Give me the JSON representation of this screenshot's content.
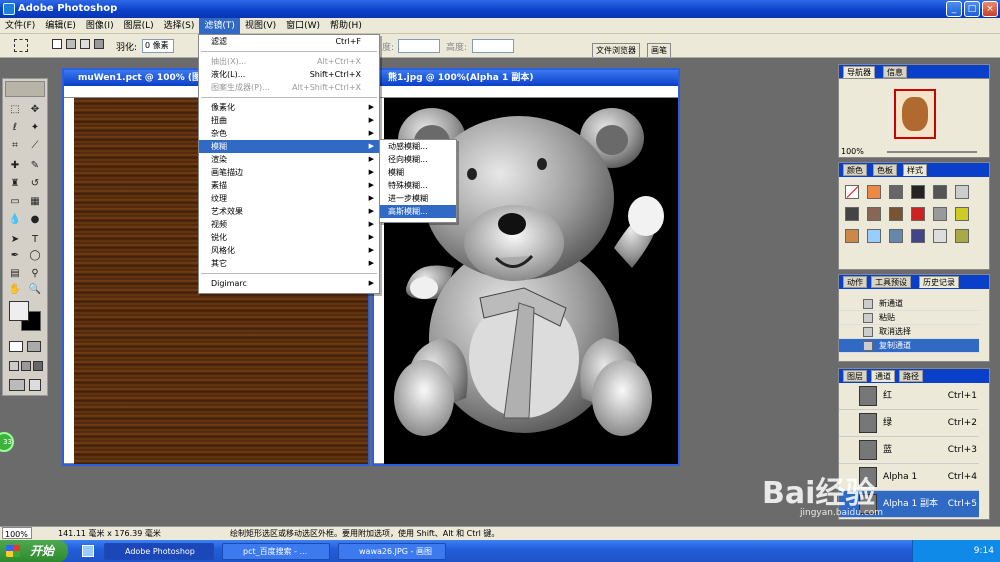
{
  "app": {
    "title": "Adobe Photoshop"
  },
  "menubar": [
    "文件(F)",
    "编辑(E)",
    "图像(I)",
    "图层(L)",
    "选择(S)",
    "滤镜(T)",
    "视图(V)",
    "窗口(W)",
    "帮助(H)"
  ],
  "options": {
    "feather_label": "羽化:",
    "feather_value": "0 像素",
    "width_label": "度:",
    "height_label": "高度:",
    "tab_file_browser": "文件浏览器",
    "tab_brushes": "画笔"
  },
  "doc1": {
    "title": "muWen1.pct @ 100% (图"
  },
  "doc2": {
    "title": "熊1.jpg @ 100%(Alpha 1 副本)"
  },
  "filter_menu": {
    "items": [
      {
        "label": "滤滤",
        "shortcut": "Ctrl+F",
        "disabled": false
      },
      {
        "sep": true
      },
      {
        "label": "抽出(X)...",
        "shortcut": "Alt+Ctrl+X",
        "disabled": true
      },
      {
        "label": "液化(L)...",
        "shortcut": "Shift+Ctrl+X",
        "disabled": false
      },
      {
        "label": "图案生成器(P)...",
        "shortcut": "Alt+Shift+Ctrl+X",
        "disabled": true
      },
      {
        "sep": true
      },
      {
        "label": "像素化",
        "sub": true
      },
      {
        "label": "扭曲",
        "sub": true
      },
      {
        "label": "杂色",
        "sub": true
      },
      {
        "label": "模糊",
        "sub": true,
        "selected": true
      },
      {
        "label": "渲染",
        "sub": true
      },
      {
        "label": "画笔描边",
        "sub": true
      },
      {
        "label": "素描",
        "sub": true
      },
      {
        "label": "纹理",
        "sub": true
      },
      {
        "label": "艺术效果",
        "sub": true
      },
      {
        "label": "视频",
        "sub": true
      },
      {
        "label": "锐化",
        "sub": true
      },
      {
        "label": "风格化",
        "sub": true
      },
      {
        "label": "其它",
        "sub": true
      },
      {
        "sep": true
      },
      {
        "label": "Digimarc",
        "sub": true
      }
    ]
  },
  "blur_menu": {
    "items": [
      "动感模糊...",
      "径向模糊...",
      "模糊",
      "特殊模糊...",
      "进一步模糊",
      "高斯模糊..."
    ],
    "selected_index": 5
  },
  "navigator": {
    "tab1": "导航器",
    "tab2": "信息",
    "zoom": "100%"
  },
  "color_panel": {
    "tab1": "颜色",
    "tab2": "色板",
    "tab3": "样式"
  },
  "history_panel": {
    "tab1": "动作",
    "tab2": "工具预设",
    "tab3": "历史记录",
    "items": [
      "新通道",
      "粘贴",
      "取消选择",
      "复制通道"
    ],
    "selected_index": 3
  },
  "channels_panel": {
    "tab1": "图层",
    "tab2": "通道",
    "tab3": "路径",
    "rows": [
      {
        "name": "红",
        "shortcut": "Ctrl+1"
      },
      {
        "name": "绿",
        "shortcut": "Ctrl+2"
      },
      {
        "name": "蓝",
        "shortcut": "Ctrl+3"
      },
      {
        "name": "Alpha 1",
        "shortcut": "Ctrl+4"
      },
      {
        "name": "Alpha 1 副本",
        "shortcut": "Ctrl+5"
      }
    ]
  },
  "status": {
    "zoom": "100%",
    "size": "141.11 毫米 x 176.39 毫米",
    "hint": "绘制矩形选区或移动选区外框。要用附加选项，使用 Shift、Alt 和 Ctrl 键。"
  },
  "taskbar": {
    "start": "开始",
    "tasks": [
      "Adobe Photoshop",
      "pct_百度搜索 - ...",
      "wawa26.JPG - 画图"
    ],
    "time": "9:14"
  },
  "watermark": {
    "text": "Bai经验",
    "url": "jingyan.baidu.com"
  },
  "colors": {
    "accent": "#316ac5",
    "titlebar": "#0a3fc9"
  }
}
